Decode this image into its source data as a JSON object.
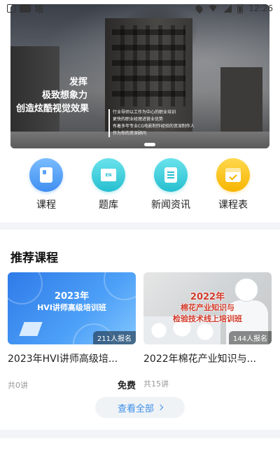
{
  "status_bar": {
    "char": "培",
    "time": "12:26"
  },
  "banner": {
    "slogan_lines": [
      "发挥",
      "极致想象力",
      "创造炫酷视觉效果"
    ],
    "tagline_lines": [
      "行业导师以工作为中心的职业培训",
      "更快的职业经理进营业优势",
      "有着多年专业CG电影制作经验的资深制作人",
      "作为你的资深顾问"
    ]
  },
  "quick_nav": [
    {
      "label": "课程",
      "icon": "book-icon"
    },
    {
      "label": "题库",
      "icon": "question-bank-icon",
      "glyph": "EN"
    },
    {
      "label": "新闻资讯",
      "icon": "news-icon"
    },
    {
      "label": "课程表",
      "icon": "calendar-icon"
    }
  ],
  "section": {
    "title": "推荐课程"
  },
  "courses": [
    {
      "thumb_line1": "2023年",
      "thumb_line2": "HVI讲师高级培训班",
      "enroll": "211人报名",
      "title": "2023年HVI讲师高级培...",
      "lessons": "共0讲",
      "price": "免费"
    },
    {
      "thumb_line1": "2022年",
      "thumb_line2": "棉花产业知识与",
      "thumb_line3": "检验技术线上培训班",
      "enroll": "144人报名",
      "title": "2022年棉花产业知识与...",
      "lessons": "共15讲",
      "price": ""
    }
  ],
  "view_all": {
    "label": "查看全部"
  }
}
